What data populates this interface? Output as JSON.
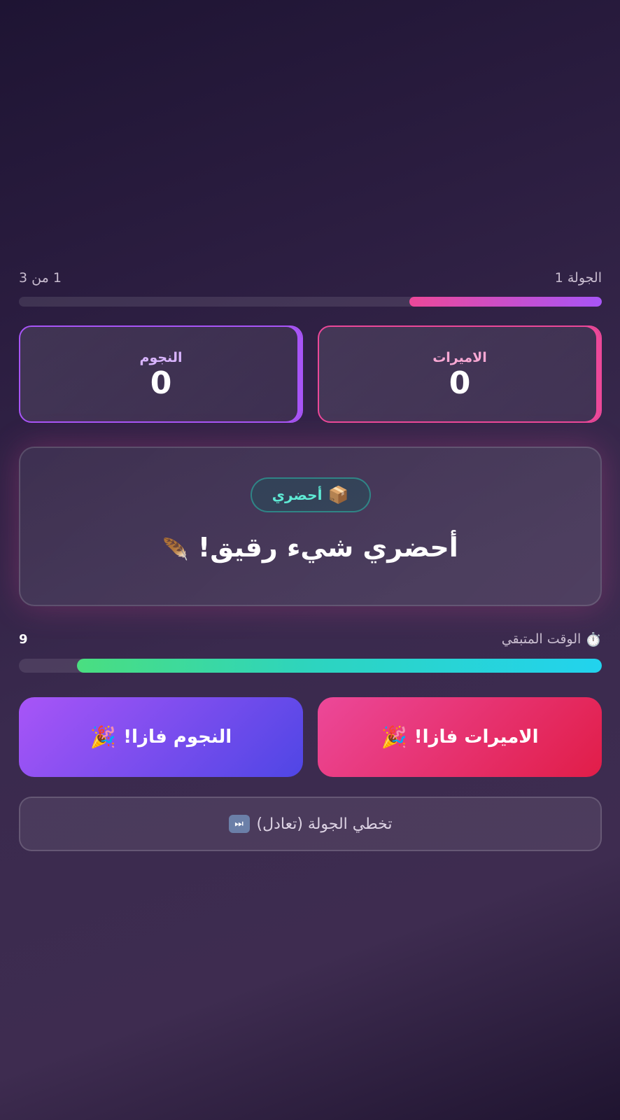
{
  "round": {
    "label": "الجولة 1",
    "counter": "1 من 3",
    "progress_fraction": 0.33
  },
  "teams": {
    "princesses": {
      "name": "الاميرات",
      "score": "0",
      "color": "#ec4899"
    },
    "stars": {
      "name": "النجوم",
      "score": "0",
      "color": "#a855f7"
    }
  },
  "challenge": {
    "category_icon": "package-icon",
    "category_emoji": "📦",
    "category_label": "أحضري",
    "text": "أحضري شيء رقيق!",
    "text_emoji": "🪶"
  },
  "timer": {
    "icon": "stopwatch-icon",
    "icon_emoji": "⏱️",
    "label": "الوقت المتبقي",
    "value": "9",
    "progress_fraction": 0.9
  },
  "buttons": {
    "princesses_win": "الاميرات فازا!",
    "stars_win": "النجوم فازا!",
    "win_emoji": "🎉",
    "skip": "تخطي الجولة (تعادل)",
    "skip_icon_glyph": "⏭"
  }
}
